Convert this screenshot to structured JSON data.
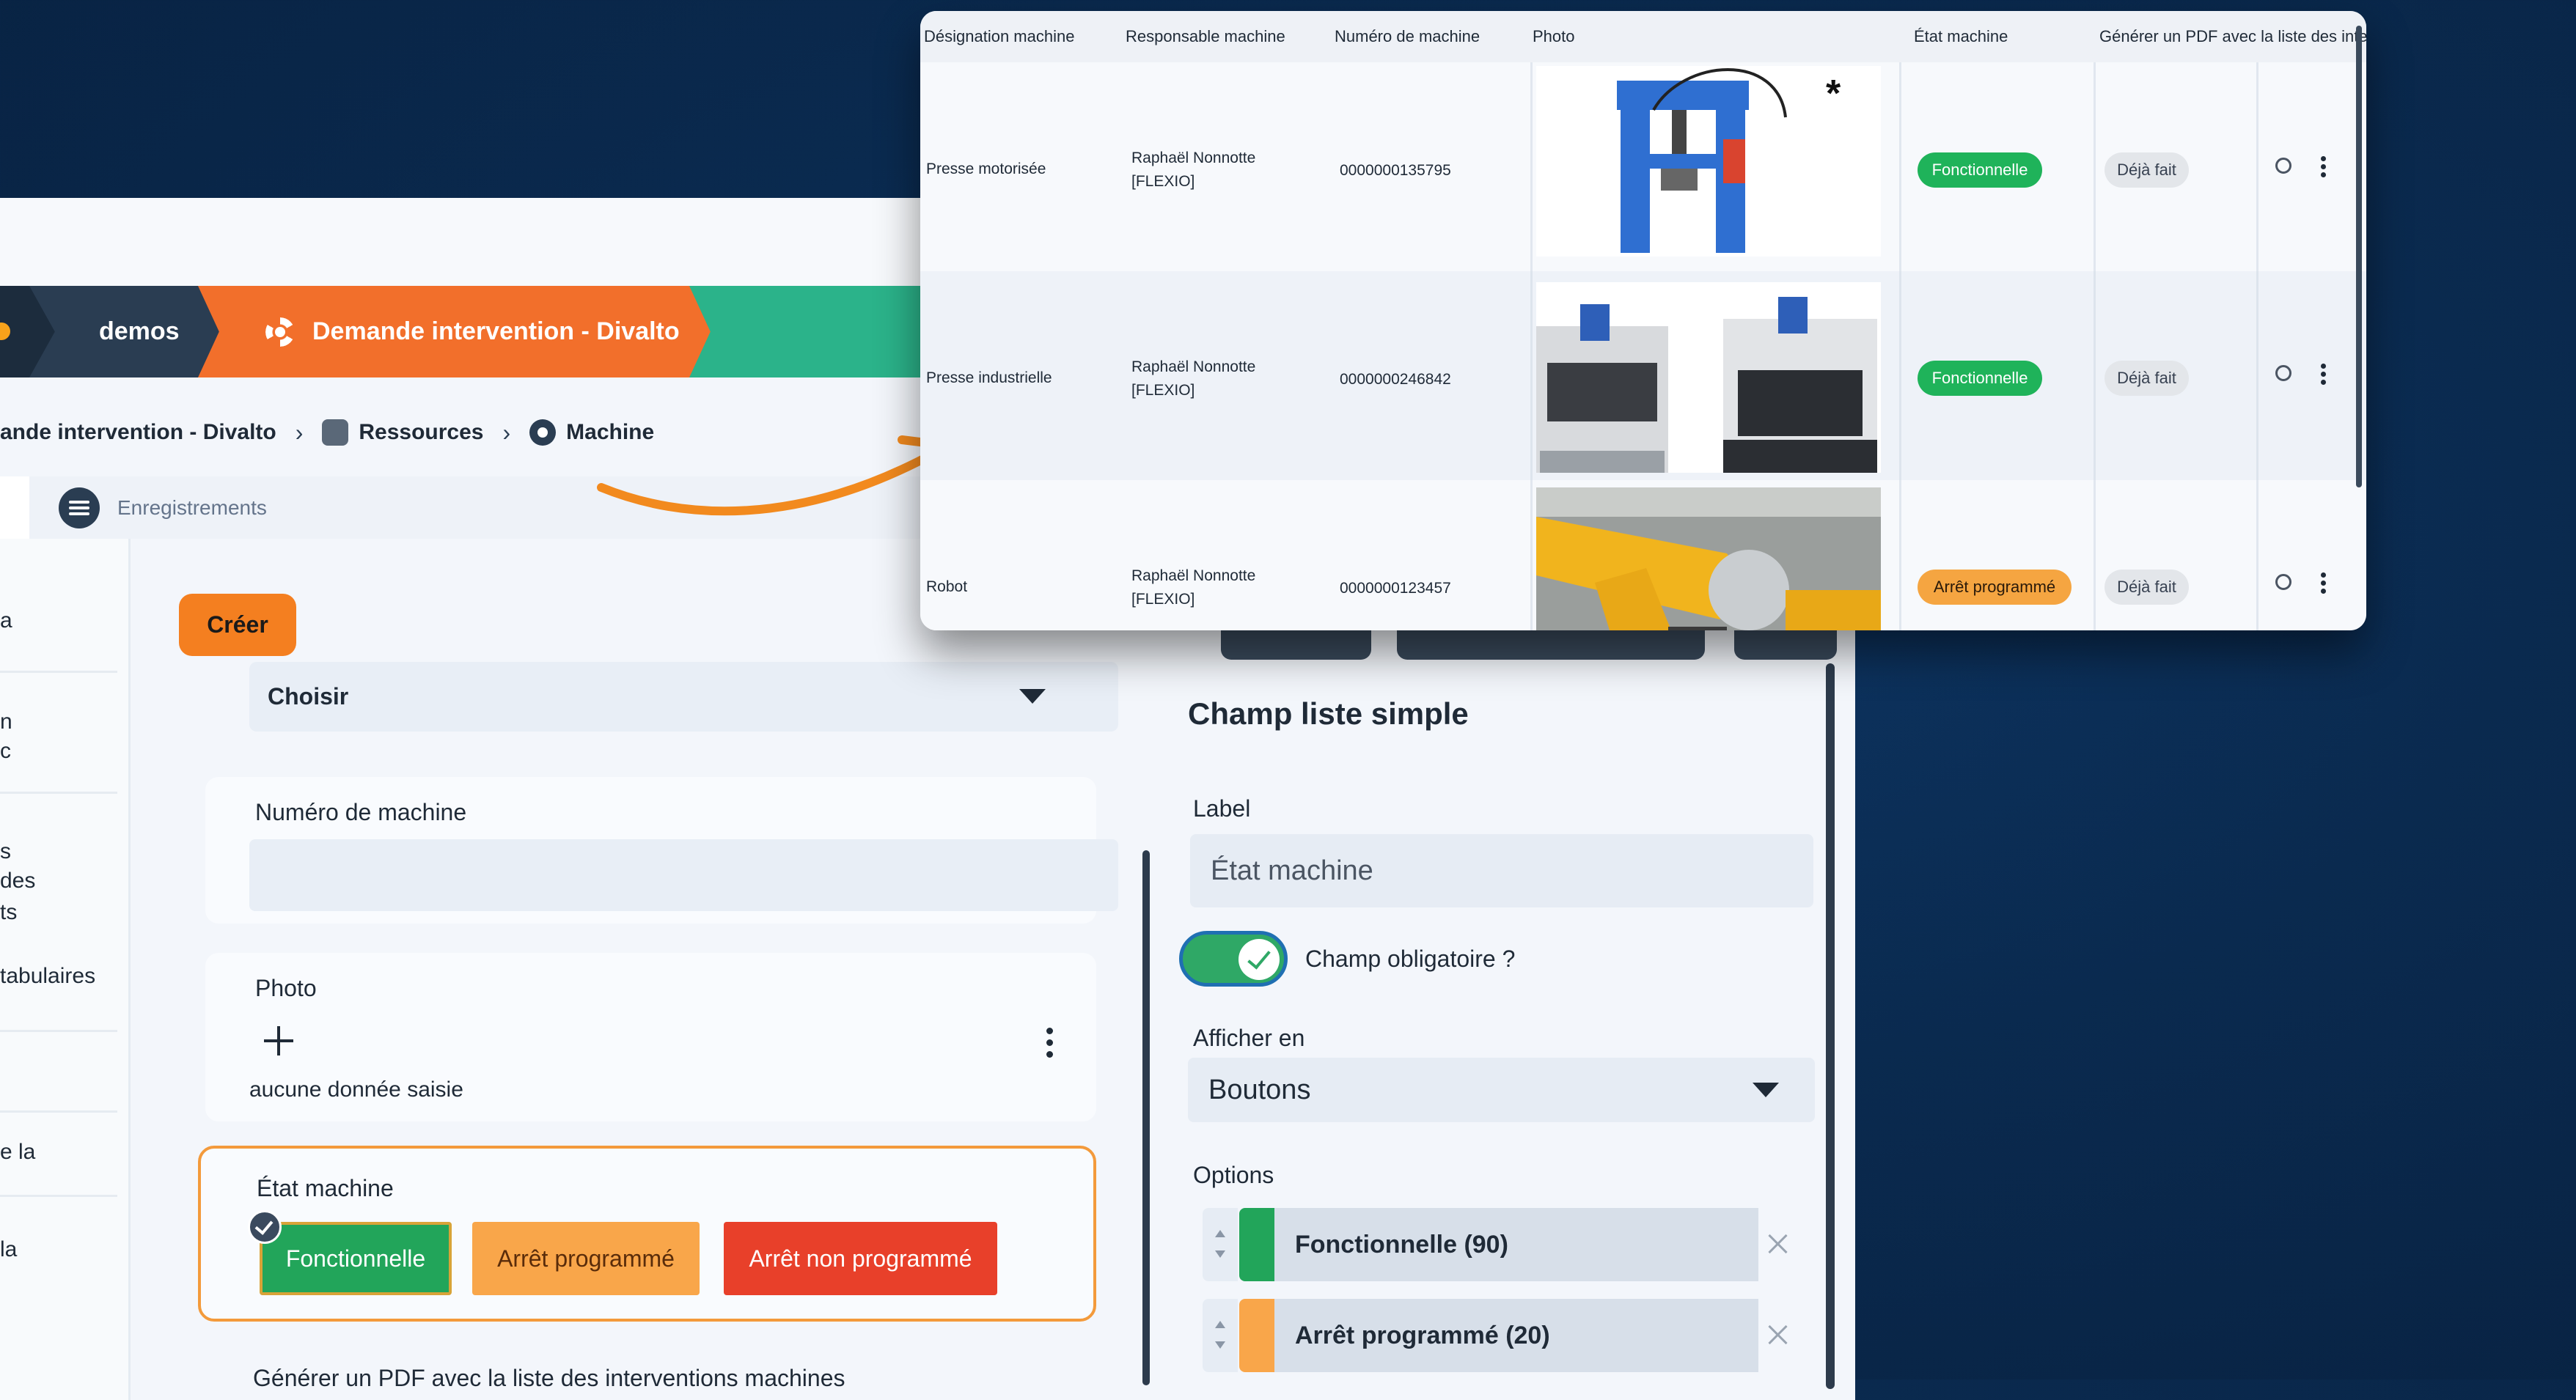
{
  "pipeline": {
    "step1": "demos",
    "step2": "Demande intervention - Divalto"
  },
  "breadcrumb": {
    "item1": "ande intervention - Divalto",
    "item2": "Ressources",
    "item3": "Machine"
  },
  "tabs": {
    "records": "Enregistrements"
  },
  "sidebar": {
    "items": [
      "a",
      "n",
      "c",
      "s",
      "des",
      "ts",
      "tabulaires",
      "e la",
      "la"
    ]
  },
  "main": {
    "create_button": "Créer",
    "choose_value": "Choisir",
    "machine_number_label": "Numéro de machine",
    "photo_label": "Photo",
    "photo_empty": "aucune donnée saisie",
    "etat_label": "État machine",
    "etat_buttons": [
      "Fonctionnelle",
      "Arrêt programmé",
      "Arrêt non programmé"
    ],
    "bottom_cut_text": "Générer un PDF avec la liste des interventions machines"
  },
  "right_panel": {
    "title": "Champ liste simple",
    "label_caption": "Label",
    "label_value": "État machine",
    "required_toggle": "Champ obligatoire ?",
    "required_on": true,
    "display_caption": "Afficher en",
    "display_value": "Boutons",
    "options_caption": "Options",
    "options": [
      {
        "label": "Fonctionnelle (90)",
        "color": "#22a55a"
      },
      {
        "label": "Arrêt programmé (20)",
        "color": "#f9a64a"
      }
    ]
  },
  "table": {
    "columns": [
      "Désignation machine",
      "Responsable machine",
      "Numéro de machine",
      "Photo",
      "État machine",
      "Générer un PDF avec la liste des inte"
    ],
    "rows": [
      {
        "designation": "Presse motorisée",
        "responsable_1": "Raphaël Nonnotte",
        "responsable_2": "[FLEXIO]",
        "numero": "0000000135795",
        "etat": "Fonctionnelle",
        "pdf": "Déjà fait"
      },
      {
        "designation": "Presse industrielle",
        "responsable_1": "Raphaël Nonnotte",
        "responsable_2": "[FLEXIO]",
        "numero": "0000000246842",
        "etat": "Fonctionnelle",
        "pdf": "Déjà fait"
      },
      {
        "designation": "Robot",
        "responsable_1": "Raphaël Nonnotte",
        "responsable_2": "[FLEXIO]",
        "numero": "0000000123457",
        "etat": "Arrêt programmé",
        "pdf": "Déjà fait"
      }
    ]
  },
  "colors": {
    "accent_orange": "#f26f2b",
    "green": "#22a55a",
    "background": "#0a2a4f"
  }
}
